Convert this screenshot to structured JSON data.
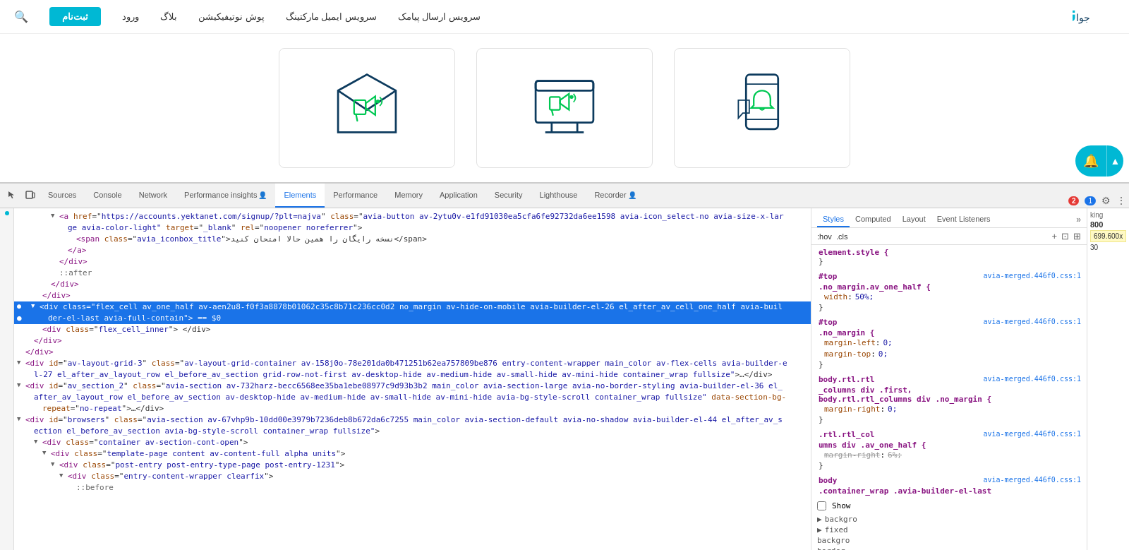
{
  "site": {
    "nav": {
      "links": [
        {
          "label": "سرویس ارسال پیامک"
        },
        {
          "label": "سرویس ایمیل مارکتینگ"
        },
        {
          "label": "پوش نوتیفیکیشن"
        },
        {
          "label": "بلاگ"
        },
        {
          "label": "ورود"
        }
      ],
      "signup_label": "ثبت‌نام",
      "search_label": "🔍"
    }
  },
  "devtools": {
    "tabs": [
      {
        "id": "inspector",
        "label": "Inspector",
        "active": false
      },
      {
        "id": "sources",
        "label": "Sources",
        "active": false
      },
      {
        "id": "console",
        "label": "Console",
        "active": false
      },
      {
        "id": "network",
        "label": "Network",
        "active": false
      },
      {
        "id": "performance-insights",
        "label": "Performance insights",
        "active": false
      },
      {
        "id": "elements",
        "label": "Elements",
        "active": true
      },
      {
        "id": "performance",
        "label": "Performance",
        "active": false
      },
      {
        "id": "memory",
        "label": "Memory",
        "active": false
      },
      {
        "id": "application",
        "label": "Application",
        "active": false
      },
      {
        "id": "security",
        "label": "Security",
        "active": false
      },
      {
        "id": "lighthouse",
        "label": "Lighthouse",
        "active": false
      },
      {
        "id": "recorder",
        "label": "Recorder",
        "active": false
      }
    ],
    "badge_red": "2",
    "badge_blue": "1",
    "styles_tabs": [
      "Styles",
      "Computed",
      "Layout",
      "Event Listeners"
    ],
    "filter_placeholder": ":hov  .cls",
    "dom_lines": [
      {
        "indent": 4,
        "arrow": "▼",
        "content": "<a href=\"https://accounts.yektanet.com/signup/?plt=najva\" class=\"avia-button av-2ytu0v-e1fd91030ea5cfa6fe92732da6ee1598 avia-icon_select-no avia-size-x-lar"
      },
      {
        "indent": 5,
        "arrow": "",
        "content": "ge avia-color-light\" target=\"_blank\" rel=\"noopener noreferrer\">"
      },
      {
        "indent": 6,
        "arrow": "",
        "content": "<span class=\"avia_iconbox_title\">نسخه رایگان را همین حالا امتحان کنید</span>"
      },
      {
        "indent": 5,
        "arrow": "",
        "content": "</a>"
      },
      {
        "indent": 4,
        "arrow": "",
        "content": "</div>"
      },
      {
        "indent": 4,
        "arrow": "",
        "content": "::after"
      },
      {
        "indent": 3,
        "arrow": "",
        "content": "</div>"
      },
      {
        "indent": 2,
        "arrow": "",
        "content": "</div>"
      },
      {
        "indent": 1,
        "arrow": "▼",
        "highlight": true,
        "content": "<div class=\"flex_cell av_one_half av-aen2u8-f0f3a8878b01062c35c8b71c236cc0d2 no_margin av-hide-on-mobile  avia-builder-el-26  el_after_av_cell_one_half  avia-buil"
      },
      {
        "indent": 2,
        "arrow": "",
        "highlight": true,
        "content": "der-el-last  avia-full-contain\"> == $0"
      },
      {
        "indent": 2,
        "arrow": "",
        "content": "<div class=\"flex_cell_inner\"> </div>"
      },
      {
        "indent": 1,
        "arrow": "",
        "content": "</div>"
      },
      {
        "indent": 0,
        "arrow": "",
        "content": "</div>"
      },
      {
        "indent": 0,
        "arrow": "▼",
        "content": "<div id=\"av-layout-grid-3\" class=\"av-layout-grid-container av-158j0o-78e201da0b471251b62ea757809be876 entry-content-wrapper main_color av-flex-cells  avia-builder-e"
      },
      {
        "indent": 1,
        "arrow": "",
        "content": "l-27  el_after_av_layout_row  el_before_av_section  grid-row-not-first av-desktop-hide av-medium-hide av-small-hide av-mini-hide container_wrap fullsize\">…</div>"
      },
      {
        "indent": 0,
        "arrow": "▼",
        "content": "<div id=\"av_section_2\" class=\"avia-section av-732harz-becc6568ee35ba1ebe08977c9d93b3b2 main_color avia-section-large avia-no-border-styling  avia-builder-el-36  el_"
      },
      {
        "indent": 1,
        "arrow": "",
        "content": "after_av_layout_row  el_before_av_section  av-desktop-hide av-medium-hide av-small-hide av-mini-hide avia-bg-style-scroll container_wrap fullsize\" data-section-bg-"
      },
      {
        "indent": 2,
        "arrow": "",
        "content": "repeat=\"no-repeat\">…</div>"
      },
      {
        "indent": 0,
        "arrow": "▼",
        "content": "<div id=\"browsers\" class=\"avia-section av-67vhp9b-10dd00e3979b7236deb8b672da6c7255 main_color avia-section-default avia-no-shadow  avia-builder-el-44  el_after_av_s"
      },
      {
        "indent": 1,
        "arrow": "",
        "content": "ection  el_before_av_section  avia-bg-style-scroll container_wrap fullsize\">"
      },
      {
        "indent": 2,
        "arrow": "▼",
        "content": "<div class=\"container av-section-cont-open\">"
      },
      {
        "indent": 3,
        "arrow": "▼",
        "content": "<div class=\"template-page content  av-content-full alpha units\">"
      },
      {
        "indent": 4,
        "arrow": "▼",
        "content": "<div class=\"post-entry post-entry-type-page post-entry-1231\">"
      },
      {
        "indent": 5,
        "arrow": "▼",
        "content": "<div class=\"entry-content-wrapper clearfix\">"
      },
      {
        "indent": 6,
        "arrow": "",
        "content": "::before"
      }
    ],
    "styles": [
      {
        "selector": "element.style {",
        "source": "",
        "props": [],
        "close": "}"
      },
      {
        "selector": "#top",
        "source": "avia-merged.446f0.css:1",
        "block": ".no_margin.av_one_half {",
        "props": [
          {
            "name": "width",
            "value": "50%;"
          }
        ],
        "close": "}"
      },
      {
        "selector": "#top",
        "source": "avia-merged.446f0.css:1",
        "block": ".no_margin {",
        "props": [
          {
            "name": "margin-left",
            "value": "0;"
          },
          {
            "name": "margin-top",
            "value": "0;"
          }
        ],
        "close": "}"
      },
      {
        "selector": "body.rtl.rtl",
        "source": "avia-merged.446f0.css:1",
        "block": "_columns div .first,",
        "props2": "body.rtl.rtl_columns div .no_margin {",
        "props": [
          {
            "name": "margin-right",
            "value": "0;"
          }
        ],
        "close": "}"
      },
      {
        "selector": ".rtl.rtl_col",
        "source": "avia-merged.446f0.css:1",
        "block": "umns div .av_one_half {",
        "props": [
          {
            "name": "margin-right",
            "value": "6%;",
            "strikethrough": true
          }
        ],
        "close": "}"
      },
      {
        "selector": "body",
        "source": "avia-merged.446f0.css:1",
        "block": ".container_wrap .avia-builder-el-last",
        "props": [],
        "close": ""
      }
    ],
    "right_sidebar": {
      "label1": "king",
      "val1": "800",
      "val2": "699.600x",
      "val3": "30"
    }
  }
}
